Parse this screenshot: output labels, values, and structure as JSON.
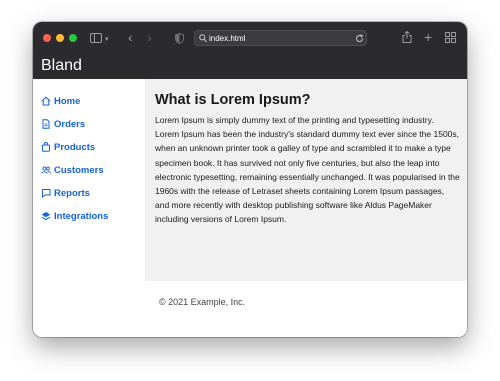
{
  "browser": {
    "address": "index.html"
  },
  "header": {
    "brand": "Bland"
  },
  "sidebar": {
    "items": [
      {
        "label": "Home",
        "icon": "house-icon"
      },
      {
        "label": "Orders",
        "icon": "file-icon"
      },
      {
        "label": "Products",
        "icon": "cart-icon"
      },
      {
        "label": "Customers",
        "icon": "users-icon"
      },
      {
        "label": "Reports",
        "icon": "chart-icon"
      },
      {
        "label": "Integrations",
        "icon": "layers-icon"
      }
    ]
  },
  "main": {
    "heading": "What is Lorem Ipsum?",
    "paragraph": "Lorem Ipsum is simply dummy text of the printing and typesetting industry. Lorem Ipsum has been the industry's standard dummy text ever since the 1500s, when an unknown printer took a galley of type and scrambled it to make a type specimen book. It has survived not only five centuries, but also the leap into electronic typesetting, remaining essentially unchanged. It was popularised in the 1960s with the release of Letraset sheets containing Lorem Ipsum passages, and more recently with desktop publishing software like Aldus PageMaker including versions of Lorem Ipsum."
  },
  "footer": {
    "text": "© 2021 Example, Inc."
  },
  "colors": {
    "accent": "#1463d9",
    "header_bg": "#2b2b2d",
    "main_bg": "#f1f1f1"
  }
}
